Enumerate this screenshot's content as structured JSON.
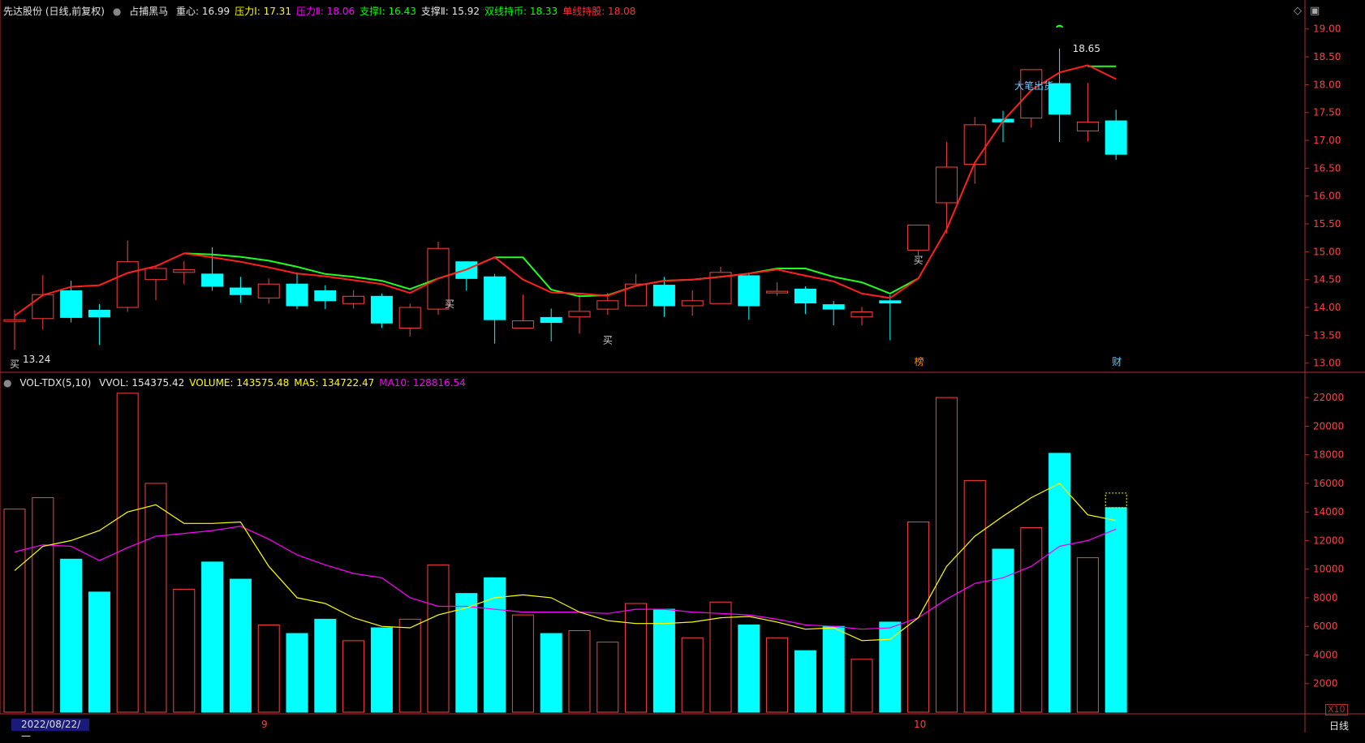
{
  "header_price": {
    "title": "先达股份 (日线,前复权)",
    "indicator": "占捕黑马",
    "items": [
      {
        "label": "重心: 16.99",
        "color": "#e6e6e6"
      },
      {
        "label": "压力Ⅰ: 17.31",
        "color": "#ffff00"
      },
      {
        "label": "压力Ⅱ: 18.06",
        "color": "#ff00ff"
      },
      {
        "label": "支撑Ⅰ: 16.43",
        "color": "#00ff00"
      },
      {
        "label": "支撑Ⅱ: 15.92",
        "color": "#e6e6e6"
      },
      {
        "label": "双线持币: 18.33",
        "color": "#00ff00"
      },
      {
        "label": "单线持股: 18.08",
        "color": "#ff3030"
      }
    ]
  },
  "header_volume": {
    "title": "VOL-TDX(5,10)",
    "items": [
      {
        "label": "VVOL: 154375.42",
        "color": "#e6e6e6"
      },
      {
        "label": "VOLUME: 143575.48",
        "color": "#ffff00"
      },
      {
        "label": "MA5: 134722.47",
        "color": "#ffff00"
      },
      {
        "label": "MA10: 128816.54",
        "color": "#ff00ff"
      }
    ]
  },
  "footer": {
    "date_label": "2022/08/22/一",
    "month_9": "9",
    "month_10": "10",
    "period": "日线",
    "scale_badge": "X10"
  },
  "colors": {
    "up": "#ff4040",
    "down": "#00ffff",
    "line_red": "#ff2020",
    "line_green": "#20ff20",
    "ma5": "#ffff00",
    "ma10": "#ff00ff",
    "axis": "#b03030"
  },
  "chart_data": [
    {
      "type": "candlestick",
      "ylim": [
        12.85,
        19.2
      ],
      "yticks": [
        "13.00",
        "13.50",
        "14.00",
        "14.50",
        "15.00",
        "15.50",
        "16.00",
        "16.50",
        "17.00",
        "17.50",
        "18.00",
        "18.50",
        "19.00"
      ],
      "candles": [
        {
          "o": 13.78,
          "c": 13.78,
          "h": 13.95,
          "l": 13.24
        },
        {
          "o": 13.8,
          "c": 14.23,
          "h": 14.58,
          "l": 13.6
        },
        {
          "o": 14.3,
          "c": 13.82,
          "h": 14.48,
          "l": 13.73
        },
        {
          "o": 13.95,
          "c": 13.83,
          "h": 14.06,
          "l": 13.33
        },
        {
          "o": 14.0,
          "c": 14.82,
          "h": 15.2,
          "l": 13.92
        },
        {
          "o": 14.5,
          "c": 14.7,
          "h": 14.76,
          "l": 14.13
        },
        {
          "o": 14.63,
          "c": 14.68,
          "h": 14.83,
          "l": 14.42
        },
        {
          "o": 14.6,
          "c": 14.38,
          "h": 15.08,
          "l": 14.3
        },
        {
          "o": 14.35,
          "c": 14.23,
          "h": 14.55,
          "l": 14.08
        },
        {
          "o": 14.17,
          "c": 14.42,
          "h": 14.52,
          "l": 14.07
        },
        {
          "o": 14.42,
          "c": 14.03,
          "h": 14.63,
          "l": 13.97
        },
        {
          "o": 14.3,
          "c": 14.12,
          "h": 14.4,
          "l": 13.97
        },
        {
          "o": 14.07,
          "c": 14.2,
          "h": 14.31,
          "l": 13.98
        },
        {
          "o": 14.2,
          "c": 13.72,
          "h": 14.25,
          "l": 13.63
        },
        {
          "o": 13.63,
          "c": 14.0,
          "h": 14.07,
          "l": 13.48
        },
        {
          "o": 13.97,
          "c": 15.06,
          "h": 15.18,
          "l": 13.87
        },
        {
          "o": 14.82,
          "c": 14.52,
          "h": 14.83,
          "l": 14.3
        },
        {
          "o": 14.55,
          "c": 13.78,
          "h": 14.6,
          "l": 13.35
        },
        {
          "o": 13.63,
          "c": 13.76,
          "h": 14.23,
          "l": 13.63
        },
        {
          "o": 13.82,
          "c": 13.73,
          "h": 13.98,
          "l": 13.39
        },
        {
          "o": 13.83,
          "c": 13.93,
          "h": 14.25,
          "l": 13.53
        },
        {
          "o": 13.97,
          "c": 14.12,
          "h": 14.26,
          "l": 13.87
        },
        {
          "o": 14.03,
          "c": 14.42,
          "h": 14.6,
          "l": 14.03
        },
        {
          "o": 14.4,
          "c": 14.03,
          "h": 14.55,
          "l": 13.83
        },
        {
          "o": 14.03,
          "c": 14.12,
          "h": 14.31,
          "l": 13.85
        },
        {
          "o": 14.07,
          "c": 14.63,
          "h": 14.73,
          "l": 14.07
        },
        {
          "o": 14.57,
          "c": 14.03,
          "h": 14.63,
          "l": 13.78
        },
        {
          "o": 14.27,
          "c": 14.29,
          "h": 14.45,
          "l": 14.21
        },
        {
          "o": 14.33,
          "c": 14.08,
          "h": 14.38,
          "l": 13.88
        },
        {
          "o": 14.05,
          "c": 13.97,
          "h": 14.12,
          "l": 13.68
        },
        {
          "o": 13.83,
          "c": 13.92,
          "h": 14.01,
          "l": 13.68
        },
        {
          "o": 14.12,
          "c": 14.08,
          "h": 14.22,
          "l": 13.41
        },
        {
          "o": 15.03,
          "c": 15.48,
          "h": 15.48,
          "l": 14.93
        },
        {
          "o": 15.88,
          "c": 16.52,
          "h": 16.97,
          "l": 15.33
        },
        {
          "o": 16.57,
          "c": 17.28,
          "h": 17.42,
          "l": 16.22
        },
        {
          "o": 17.38,
          "c": 17.33,
          "h": 17.53,
          "l": 16.97
        },
        {
          "o": 17.4,
          "c": 18.27,
          "h": 18.27,
          "l": 17.23
        },
        {
          "o": 18.02,
          "c": 17.47,
          "h": 18.65,
          "l": 16.97
        },
        {
          "o": 17.17,
          "c": 17.33,
          "h": 18.03,
          "l": 16.98
        },
        {
          "o": 17.35,
          "c": 16.75,
          "h": 17.55,
          "l": 16.65
        }
      ],
      "red_line": [
        13.85,
        14.22,
        14.37,
        14.4,
        14.62,
        14.74,
        14.97,
        14.9,
        14.82,
        14.72,
        14.61,
        14.56,
        14.49,
        14.42,
        14.26,
        14.52,
        14.68,
        14.9,
        14.5,
        14.27,
        14.25,
        14.21,
        14.39,
        14.48,
        14.5,
        14.55,
        14.61,
        14.68,
        14.57,
        14.47,
        14.25,
        14.17,
        14.52,
        15.4,
        16.6,
        17.35,
        17.9,
        18.22,
        18.35,
        18.1
      ],
      "green_line": [
        null,
        null,
        null,
        null,
        null,
        null,
        14.97,
        14.95,
        14.91,
        14.84,
        14.73,
        14.6,
        14.55,
        14.48,
        14.33,
        14.52,
        14.68,
        14.9,
        14.9,
        14.32,
        14.2,
        14.22,
        14.39,
        14.48,
        14.5,
        14.55,
        14.61,
        14.7,
        14.7,
        14.55,
        14.45,
        14.25,
        14.52,
        null,
        null,
        null,
        null,
        null,
        18.33,
        18.33
      ],
      "annotations": [
        "13.24",
        "18.65",
        "大笔出货",
        "买",
        "榜",
        "财"
      ]
    },
    {
      "type": "bar",
      "ylim": [
        0,
        22800
      ],
      "yticks": [
        "2000",
        "4000",
        "6000",
        "8000",
        "10000",
        "12000",
        "14000",
        "16000",
        "18000",
        "20000",
        "22000"
      ],
      "volumes": [
        14200,
        15000,
        10700,
        8400,
        22300,
        16000,
        8600,
        10500,
        9300,
        6100,
        5500,
        6500,
        5000,
        5900,
        6500,
        10300,
        8300,
        9400,
        6800,
        5500,
        5700,
        4900,
        7600,
        7200,
        5200,
        7700,
        6100,
        5200,
        4300,
        6000,
        3700,
        6300,
        13300,
        22000,
        16200,
        11400,
        12900,
        18100,
        10800,
        14300
      ],
      "ma5": [
        9900,
        11600,
        12000,
        12700,
        14000,
        14500,
        13200,
        13200,
        13300,
        10200,
        8000,
        7600,
        6600,
        6000,
        5900,
        6800,
        7300,
        8000,
        8200,
        8000,
        7000,
        6400,
        6200,
        6200,
        6300,
        6600,
        6700,
        6300,
        5800,
        5900,
        5000,
        5100,
        6600,
        10200,
        12300,
        13700,
        15000,
        16000,
        13800,
        13400
      ],
      "ma10": [
        11200,
        11700,
        11600,
        10600,
        11500,
        12300,
        12500,
        12700,
        13000,
        12100,
        11000,
        10300,
        9700,
        9400,
        8000,
        7400,
        7400,
        7200,
        7000,
        7000,
        7000,
        6900,
        7200,
        7200,
        7000,
        6900,
        6800,
        6500,
        6100,
        6000,
        5800,
        5900,
        6600,
        7900,
        9000,
        9400,
        10200,
        11600,
        12000,
        12800
      ]
    }
  ]
}
